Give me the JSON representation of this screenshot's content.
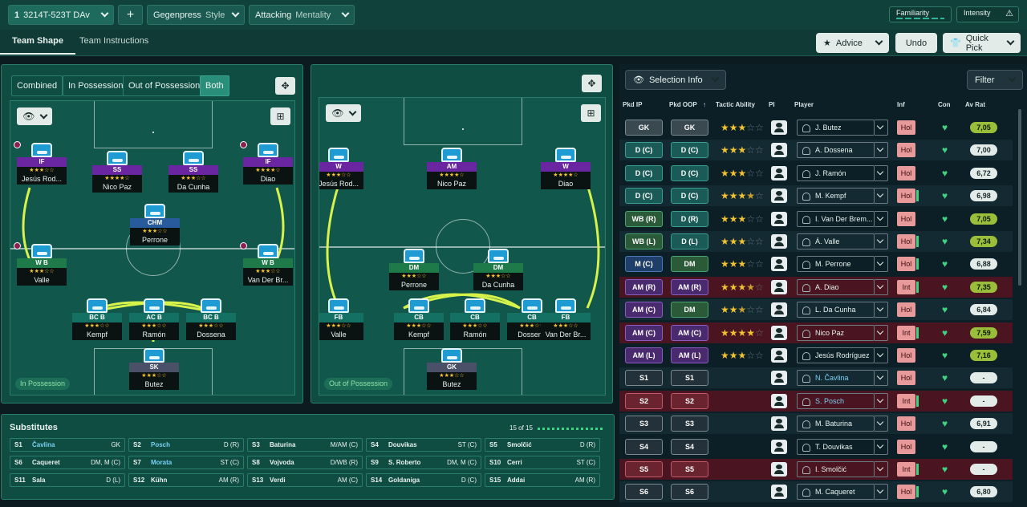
{
  "topbar": {
    "formation_number": "1",
    "formation": "3214T-523T DAv",
    "style_value": "Gegenpress",
    "style_label": "Style",
    "mentality_value": "Attacking",
    "mentality_label": "Mentality",
    "familiarity": "Familiarity",
    "intensity": "Intensity"
  },
  "subbar": {
    "tab_shape": "Team Shape",
    "tab_instructions": "Team Instructions",
    "advice": "Advice",
    "undo": "Undo",
    "quick_pick": "Quick Pick"
  },
  "left_pitch": {
    "tabs": [
      "Combined",
      "In Possession",
      "Out of Possession",
      "Both"
    ],
    "label": "In Possession",
    "players": [
      {
        "role": "IF",
        "name": "Jesús Rod...",
        "color": "purple",
        "stars": "★★★☆☆"
      },
      {
        "role": "SS",
        "name": "Nico Paz",
        "color": "purple",
        "stars": "★★★★☆"
      },
      {
        "role": "SS",
        "name": "Da Cunha",
        "color": "purple",
        "stars": "★★★☆☆"
      },
      {
        "role": "IF",
        "name": "Diao",
        "color": "purple",
        "stars": "★★★★☆"
      },
      {
        "role": "CHM",
        "name": "Perrone",
        "color": "blue",
        "stars": "★★★☆☆"
      },
      {
        "role": "W B",
        "name": "Valle",
        "color": "green",
        "stars": "★★★☆☆"
      },
      {
        "role": "W B",
        "name": "Van Der Br...",
        "color": "green",
        "stars": "★★★☆☆"
      },
      {
        "role": "BC B",
        "name": "Kempf",
        "color": "teal",
        "stars": "★★★☆☆"
      },
      {
        "role": "AC B",
        "name": "Ramón",
        "color": "teal",
        "stars": "★★★☆☆"
      },
      {
        "role": "BC B",
        "name": "Dossena",
        "color": "teal",
        "stars": "★★★☆☆"
      },
      {
        "role": "SK",
        "name": "Butez",
        "color": "grey",
        "stars": "★★★☆☆"
      }
    ]
  },
  "right_pitch": {
    "label": "Out of Possession",
    "players": [
      {
        "role": "W",
        "name": "Jesús Rod...",
        "color": "purple",
        "stars": "★★★☆☆"
      },
      {
        "role": "AM",
        "name": "Nico Paz",
        "color": "purple",
        "stars": "★★★★☆"
      },
      {
        "role": "W",
        "name": "Diao",
        "color": "purple",
        "stars": "★★★★☆"
      },
      {
        "role": "DM",
        "name": "Perrone",
        "color": "green",
        "stars": "★★★☆☆"
      },
      {
        "role": "DM",
        "name": "Da Cunha",
        "color": "green",
        "stars": "★★★☆☆"
      },
      {
        "role": "FB",
        "name": "Valle",
        "color": "teal",
        "stars": "★★★☆☆"
      },
      {
        "role": "CB",
        "name": "Kempf",
        "color": "teal",
        "stars": "★★★☆☆"
      },
      {
        "role": "CB",
        "name": "Ramón",
        "color": "teal",
        "stars": "★★★☆☆"
      },
      {
        "role": "CB",
        "name": "Dossena",
        "color": "teal",
        "stars": "★★★☆☆"
      },
      {
        "role": "FB",
        "name": "Van Der Br...",
        "color": "teal",
        "stars": "★★★☆☆"
      },
      {
        "role": "GK",
        "name": "Butez",
        "color": "grey",
        "stars": "★★★☆☆"
      }
    ]
  },
  "substitutes": {
    "title": "Substitutes",
    "count": "15 of 15",
    "items": [
      {
        "n": "S1",
        "name": "Čavlina",
        "pos": "GK",
        "hi": true
      },
      {
        "n": "S2",
        "name": "Posch",
        "pos": "D (R)",
        "hi": true
      },
      {
        "n": "S3",
        "name": "Baturina",
        "pos": "M/AM (C)",
        "hi": false
      },
      {
        "n": "S4",
        "name": "Douvikas",
        "pos": "ST (C)",
        "hi": false
      },
      {
        "n": "S5",
        "name": "Smolčić",
        "pos": "D (R)",
        "hi": false
      },
      {
        "n": "S6",
        "name": "Caqueret",
        "pos": "DM, M (C)",
        "hi": false
      },
      {
        "n": "S7",
        "name": "Morata",
        "pos": "ST (C)",
        "hi": true
      },
      {
        "n": "S8",
        "name": "Vojvoda",
        "pos": "D/WB (R)",
        "hi": false
      },
      {
        "n": "S9",
        "name": "S. Roberto",
        "pos": "DM, M (C)",
        "hi": false
      },
      {
        "n": "S10",
        "name": "Cerri",
        "pos": "ST (C)",
        "hi": false
      },
      {
        "n": "S11",
        "name": "Sala",
        "pos": "D (L)",
        "hi": false
      },
      {
        "n": "S12",
        "name": "Kühn",
        "pos": "AM (R)",
        "hi": false
      },
      {
        "n": "S13",
        "name": "Verdi",
        "pos": "AM (C)",
        "hi": false
      },
      {
        "n": "S14",
        "name": "Goldaniga",
        "pos": "D (C)",
        "hi": false
      },
      {
        "n": "S15",
        "name": "Addai",
        "pos": "AM (R)",
        "hi": false
      }
    ]
  },
  "selection": {
    "title": "Selection Info",
    "filter": "Filter",
    "headers": [
      "Pkd IP",
      "Pkd OOP",
      "Tactic Ability",
      "PI",
      "Player",
      "Inf",
      "Con",
      "Av Rat"
    ],
    "rows": [
      {
        "ip": "GK",
        "oop": "GK",
        "ipc": "b-grey",
        "oopc": "b-grey",
        "stars": 3,
        "half": false,
        "player": "J. Butez",
        "hi": false,
        "inf": "Hol",
        "bar": false,
        "rat": "7,05",
        "ratc": "g",
        "rowc": ""
      },
      {
        "ip": "D (C)",
        "oop": "D (C)",
        "ipc": "b-teal",
        "oopc": "b-teal",
        "stars": 3,
        "half": false,
        "player": "A. Dossena",
        "hi": false,
        "inf": "Hol",
        "bar": false,
        "rat": "7,00",
        "ratc": "d",
        "rowc": "alt"
      },
      {
        "ip": "D (C)",
        "oop": "D (C)",
        "ipc": "b-teal",
        "oopc": "b-teal",
        "stars": 3,
        "half": false,
        "player": "J. Ramón",
        "hi": false,
        "inf": "Hol",
        "bar": false,
        "rat": "6,72",
        "ratc": "d",
        "rowc": ""
      },
      {
        "ip": "D (C)",
        "oop": "D (C)",
        "ipc": "b-teal",
        "oopc": "b-teal",
        "stars": 3,
        "half": true,
        "player": "M. Kempf",
        "hi": false,
        "inf": "Hol",
        "bar": true,
        "rat": "6,98",
        "ratc": "d",
        "rowc": "alt"
      },
      {
        "ip": "WB (R)",
        "oop": "D (R)",
        "ipc": "b-green",
        "oopc": "b-teal",
        "stars": 3,
        "half": false,
        "player": "I. Van Der Brem...",
        "hi": false,
        "inf": "Hol",
        "bar": false,
        "rat": "7,05",
        "ratc": "g",
        "rowc": ""
      },
      {
        "ip": "WB (L)",
        "oop": "D (L)",
        "ipc": "b-green",
        "oopc": "b-teal",
        "stars": 3,
        "half": false,
        "player": "Á. Valle",
        "hi": false,
        "inf": "Hol",
        "bar": true,
        "rat": "7,34",
        "ratc": "g",
        "rowc": "alt"
      },
      {
        "ip": "M (C)",
        "oop": "DM",
        "ipc": "b-blue",
        "oopc": "b-green",
        "stars": 3,
        "half": false,
        "player": "M. Perrone",
        "hi": false,
        "inf": "Hol",
        "bar": true,
        "rat": "6,88",
        "ratc": "d",
        "rowc": ""
      },
      {
        "ip": "AM (R)",
        "oop": "AM (R)",
        "ipc": "b-purple",
        "oopc": "b-purple",
        "stars": 3,
        "half": true,
        "player": "A. Diao",
        "hi": false,
        "inf": "Int",
        "bar": true,
        "rat": "7,35",
        "ratc": "g",
        "rowc": "red"
      },
      {
        "ip": "AM (C)",
        "oop": "DM",
        "ipc": "b-purple",
        "oopc": "b-green",
        "stars": 2,
        "half": true,
        "player": "L. Da Cunha",
        "hi": false,
        "inf": "Hol",
        "bar": false,
        "rat": "6,84",
        "ratc": "d",
        "rowc": "alt"
      },
      {
        "ip": "AM (C)",
        "oop": "AM (C)",
        "ipc": "b-purple",
        "oopc": "b-purple",
        "stars": 4,
        "half": false,
        "player": "Nico Paz",
        "hi": false,
        "inf": "Int",
        "bar": true,
        "rat": "7,59",
        "ratc": "g",
        "rowc": "red"
      },
      {
        "ip": "AM (L)",
        "oop": "AM (L)",
        "ipc": "b-purple",
        "oopc": "b-purple",
        "stars": 3,
        "half": false,
        "player": "Jesús Rodríguez",
        "hi": false,
        "inf": "Hol",
        "bar": false,
        "rat": "7,16",
        "ratc": "g",
        "rowc": ""
      },
      {
        "ip": "S1",
        "oop": "S1",
        "ipc": "b-dark",
        "oopc": "b-dark",
        "stars": 0,
        "half": false,
        "player": "N. Čavlina",
        "hi": true,
        "inf": "Hol",
        "bar": false,
        "rat": "-",
        "ratc": "d",
        "rowc": "alt"
      },
      {
        "ip": "S2",
        "oop": "S2",
        "ipc": "b-red",
        "oopc": "b-red",
        "stars": 0,
        "half": false,
        "player": "S. Posch",
        "hi": true,
        "inf": "Int",
        "bar": true,
        "rat": "-",
        "ratc": "d",
        "rowc": "red"
      },
      {
        "ip": "S3",
        "oop": "S3",
        "ipc": "b-dark",
        "oopc": "b-dark",
        "stars": 0,
        "half": false,
        "player": "M. Baturina",
        "hi": false,
        "inf": "Hol",
        "bar": false,
        "rat": "6,91",
        "ratc": "d",
        "rowc": "alt"
      },
      {
        "ip": "S4",
        "oop": "S4",
        "ipc": "b-dark",
        "oopc": "b-dark",
        "stars": 0,
        "half": false,
        "player": "T. Douvikas",
        "hi": false,
        "inf": "Hol",
        "bar": false,
        "rat": "-",
        "ratc": "d",
        "rowc": ""
      },
      {
        "ip": "S5",
        "oop": "S5",
        "ipc": "b-red",
        "oopc": "b-red",
        "stars": 0,
        "half": false,
        "player": "I. Smolčić",
        "hi": false,
        "inf": "Int",
        "bar": true,
        "rat": "-",
        "ratc": "d",
        "rowc": "red"
      },
      {
        "ip": "S6",
        "oop": "S6",
        "ipc": "b-dark",
        "oopc": "b-dark",
        "stars": 0,
        "half": false,
        "player": "M. Caqueret",
        "hi": false,
        "inf": "Hol",
        "bar": true,
        "rat": "6,80",
        "ratc": "d",
        "rowc": "alt"
      }
    ]
  }
}
